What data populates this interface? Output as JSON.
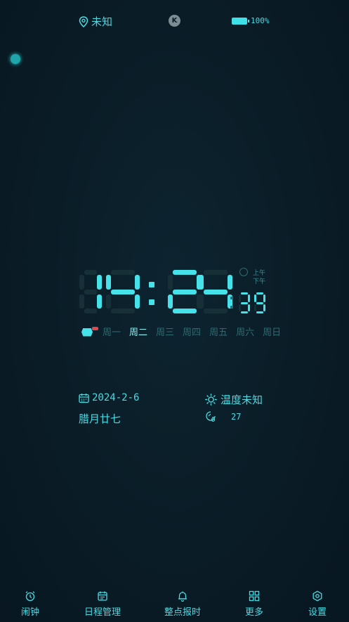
{
  "status": {
    "location": "未知",
    "app_badge": "K",
    "battery_text": "100%",
    "battery_level": 1.0
  },
  "clock": {
    "hour_tens": "1",
    "hour_ones": "4",
    "minute_tens": "2",
    "minute_ones": "4",
    "seconds": "39",
    "am_label": "上午",
    "pm_label": "下午",
    "period": "pm"
  },
  "week": {
    "days": [
      "周一",
      "周二",
      "周三",
      "周四",
      "周五",
      "周六",
      "周日"
    ],
    "active_index": 1
  },
  "info": {
    "date": "2024-2-6",
    "lunar": "腊月廿七",
    "temperature": "温度未知",
    "humidity": "27"
  },
  "nav": {
    "items": [
      {
        "label": "闹钟",
        "icon": "alarm-clock-icon"
      },
      {
        "label": "日程管理",
        "icon": "calendar-icon"
      },
      {
        "label": "整点报时",
        "icon": "bell-icon"
      },
      {
        "label": "更多",
        "icon": "grid-icon"
      },
      {
        "label": "设置",
        "icon": "settings-icon"
      }
    ]
  },
  "colors": {
    "accent": "#45e2ea",
    "segment_off": "#173038",
    "background": "#0a1c26",
    "inactive_text": "#2e6b72"
  }
}
